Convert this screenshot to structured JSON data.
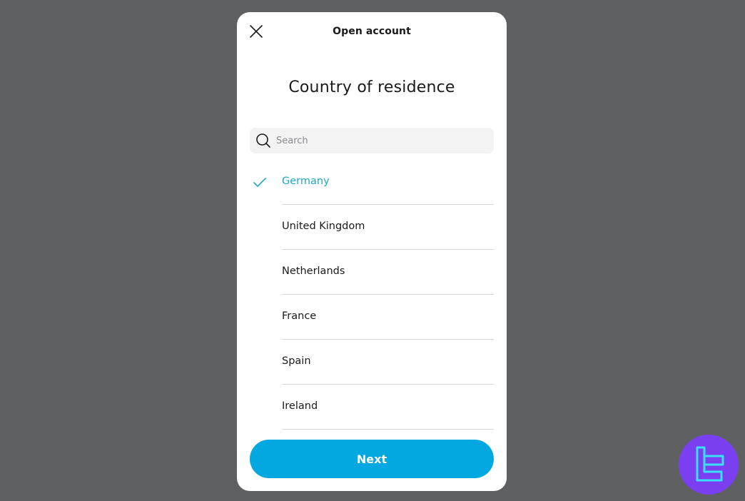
{
  "header": {
    "title": "Open account",
    "close_icon": "close-icon"
  },
  "page": {
    "title": "Country of residence"
  },
  "search": {
    "placeholder": "Search",
    "value": "",
    "icon": "search-icon"
  },
  "countries": [
    {
      "label": "Germany",
      "selected": true
    },
    {
      "label": "United Kingdom",
      "selected": false
    },
    {
      "label": "Netherlands",
      "selected": false
    },
    {
      "label": "France",
      "selected": false
    },
    {
      "label": "Spain",
      "selected": false
    },
    {
      "label": "Ireland",
      "selected": false
    }
  ],
  "actions": {
    "next_label": "Next"
  },
  "colors": {
    "backdrop": "#5f6062",
    "accent": "#03a8e0",
    "selected_text": "#1fa8c5",
    "watermark_bg": "#7b3ff2",
    "watermark_fg": "#39e0f0"
  }
}
